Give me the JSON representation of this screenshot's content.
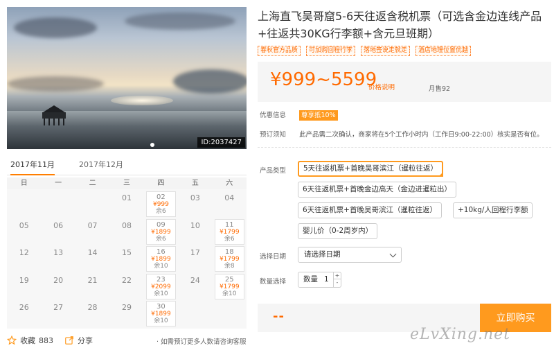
{
  "photo": {
    "id_badge": "ID:2037427"
  },
  "title": "上海直飞吴哥窟5-6天往返含税机票（可选含金边连线产品+往返共30KG行李额+含元旦班期）",
  "tags": [
    "春秋官方品质",
    "可加购回程行李",
    "落地签说走就走",
    "酒店地理位置优越"
  ],
  "price": {
    "range": "¥999~5599",
    "note": "价格说明",
    "sales": "月售92"
  },
  "discount": {
    "label": "优惠信息",
    "value": "尊享抵10%"
  },
  "booking_notice": {
    "label": "预订须知",
    "value": "此产品需二次确认，商家将在5个工作小时内（工作日9:00-22:00）核实是否有位。"
  },
  "product_type": {
    "label": "产品类型",
    "options": [
      "5天往返机票+首晚吴哥滨江（暹粒往返）",
      "6天往返机票+首晚金边高天（金边进暹粒出）",
      "6天往返机票+首晚吴哥滨江（暹粒往返）",
      "+10kg/人回程行李额",
      "婴儿价（0-2周岁内）"
    ]
  },
  "travel_date": {
    "label": "选择日期",
    "placeholder": "请选择日期"
  },
  "quantity": {
    "label": "数量选择",
    "prefix": "数量",
    "value": "1",
    "plus": "+",
    "minus": "-"
  },
  "buy": {
    "total": "--",
    "button": "立即购买"
  },
  "month_tabs": [
    "2017年11月",
    "2017年12月"
  ],
  "weekdays": [
    "日",
    "一",
    "二",
    "三",
    "四",
    "五",
    "六"
  ],
  "calendar": [
    {
      "day": ""
    },
    {
      "day": ""
    },
    {
      "day": ""
    },
    {
      "day": "01"
    },
    {
      "day": "02",
      "price": "¥999",
      "stock": "余6"
    },
    {
      "day": "03"
    },
    {
      "day": "04"
    },
    {
      "day": "05"
    },
    {
      "day": "06"
    },
    {
      "day": "07"
    },
    {
      "day": "08"
    },
    {
      "day": "09",
      "price": "¥1899",
      "stock": "余6"
    },
    {
      "day": "10"
    },
    {
      "day": "11",
      "price": "¥1799",
      "stock": "余6"
    },
    {
      "day": "12"
    },
    {
      "day": "13"
    },
    {
      "day": "14"
    },
    {
      "day": "15"
    },
    {
      "day": "16",
      "price": "¥1899",
      "stock": "余10"
    },
    {
      "day": "17"
    },
    {
      "day": "18",
      "price": "¥1799",
      "stock": "余8"
    },
    {
      "day": "19"
    },
    {
      "day": "20"
    },
    {
      "day": "21"
    },
    {
      "day": "22"
    },
    {
      "day": "23",
      "price": "¥2099",
      "stock": "余10"
    },
    {
      "day": "24"
    },
    {
      "day": "25",
      "price": "¥1799",
      "stock": "余10"
    },
    {
      "day": "26"
    },
    {
      "day": "27"
    },
    {
      "day": "28"
    },
    {
      "day": "29"
    },
    {
      "day": "30",
      "price": "¥1899",
      "stock": "余10"
    },
    {
      "day": ""
    },
    {
      "day": ""
    }
  ],
  "favorite": {
    "label": "收藏",
    "count": "883"
  },
  "share": {
    "label": "分享"
  },
  "consult_note": "· 如需预订更多人数请咨询客服",
  "watermark": "eLvXing.net"
}
